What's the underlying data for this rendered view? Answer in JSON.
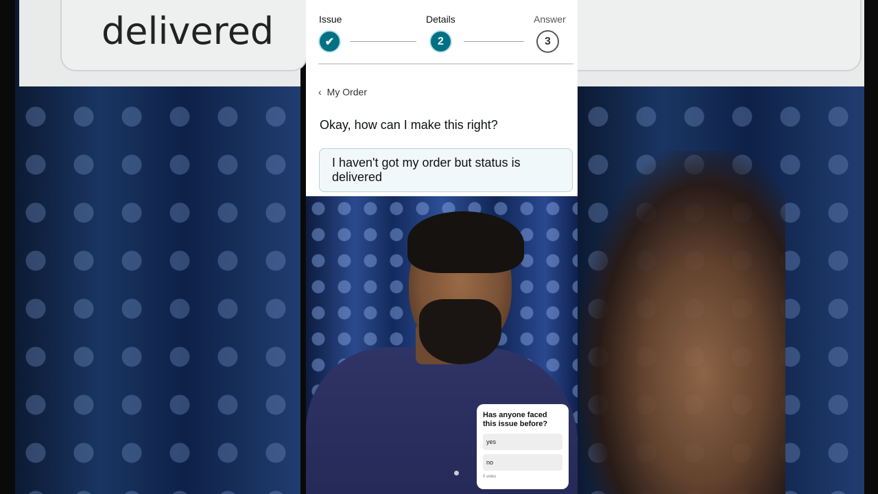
{
  "background": {
    "left_text": "delivered"
  },
  "stepper": {
    "steps": [
      {
        "label": "Issue",
        "marker": "✔",
        "state": "done"
      },
      {
        "label": "Details",
        "marker": "2",
        "state": "active"
      },
      {
        "label": "Answer",
        "marker": "3",
        "state": "todo"
      }
    ]
  },
  "nav": {
    "back_label": "My Order"
  },
  "content": {
    "question": "Okay, how can I make this right?",
    "selected_answer": "I haven't got my order but status is delivered"
  },
  "poll": {
    "question": "Has anyone faced this issue before?",
    "options": [
      "yes",
      "no"
    ],
    "votes": "0 votes"
  },
  "colors": {
    "accent": "#007185",
    "answer_bg": "#f1f8fa"
  }
}
